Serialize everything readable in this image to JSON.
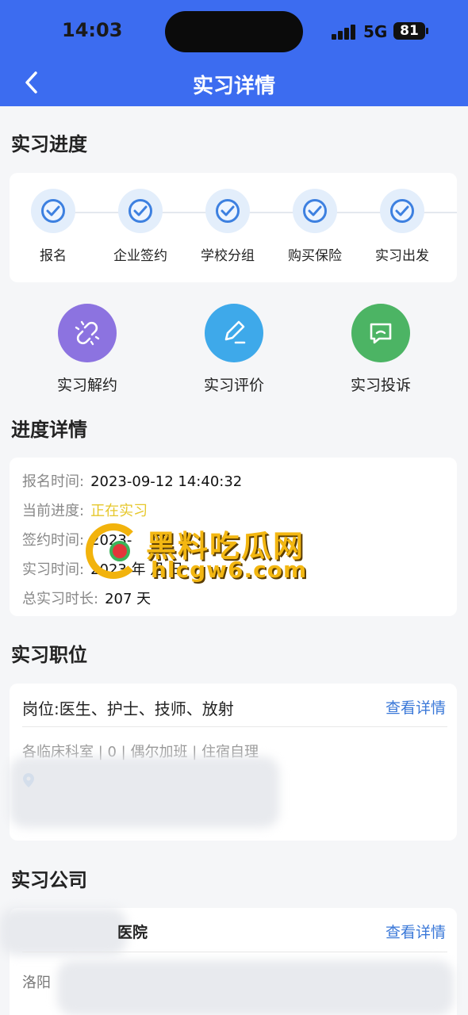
{
  "status_bar": {
    "time": "14:03",
    "network": "5G",
    "battery": "81"
  },
  "header": {
    "title": "实习详情"
  },
  "progress": {
    "title": "实习进度",
    "steps": [
      {
        "label": "报名",
        "done": true
      },
      {
        "label": "企业签约",
        "done": true
      },
      {
        "label": "学校分组",
        "done": true
      },
      {
        "label": "购买保险",
        "done": true
      },
      {
        "label": "实习出发",
        "done": true
      }
    ]
  },
  "actions": [
    {
      "label": "实习解约",
      "icon": "unlink-icon",
      "color": "#8c73e0"
    },
    {
      "label": "实习评价",
      "icon": "pencil-icon",
      "color": "#3ea9ea"
    },
    {
      "label": "实习投诉",
      "icon": "message-icon",
      "color": "#4cb464"
    }
  ],
  "details": {
    "title": "进度详情",
    "rows": [
      {
        "key": "报名时间:",
        "value": "2023-09-12 14:40:32"
      },
      {
        "key": "当前进度:",
        "value": "正在实习"
      },
      {
        "key": "签约时间:",
        "value": "2023-"
      },
      {
        "key": "实习时间:",
        "value": "2023 年 月 日"
      },
      {
        "key": "总实习时长:",
        "value": "207 天"
      }
    ]
  },
  "position": {
    "title": "实习职位",
    "job": "岗位:医生、护士、技师、放射",
    "view_label": "查看详情",
    "meta": "各临床科室 | 0 | 偶尔加班 | 住宿自理"
  },
  "company": {
    "title": "实习公司",
    "name": "医院",
    "view_label": "查看详情",
    "city": "洛阳"
  },
  "watermark": {
    "text": "黑料吃瓜网",
    "url": "hlcgw6.com"
  }
}
